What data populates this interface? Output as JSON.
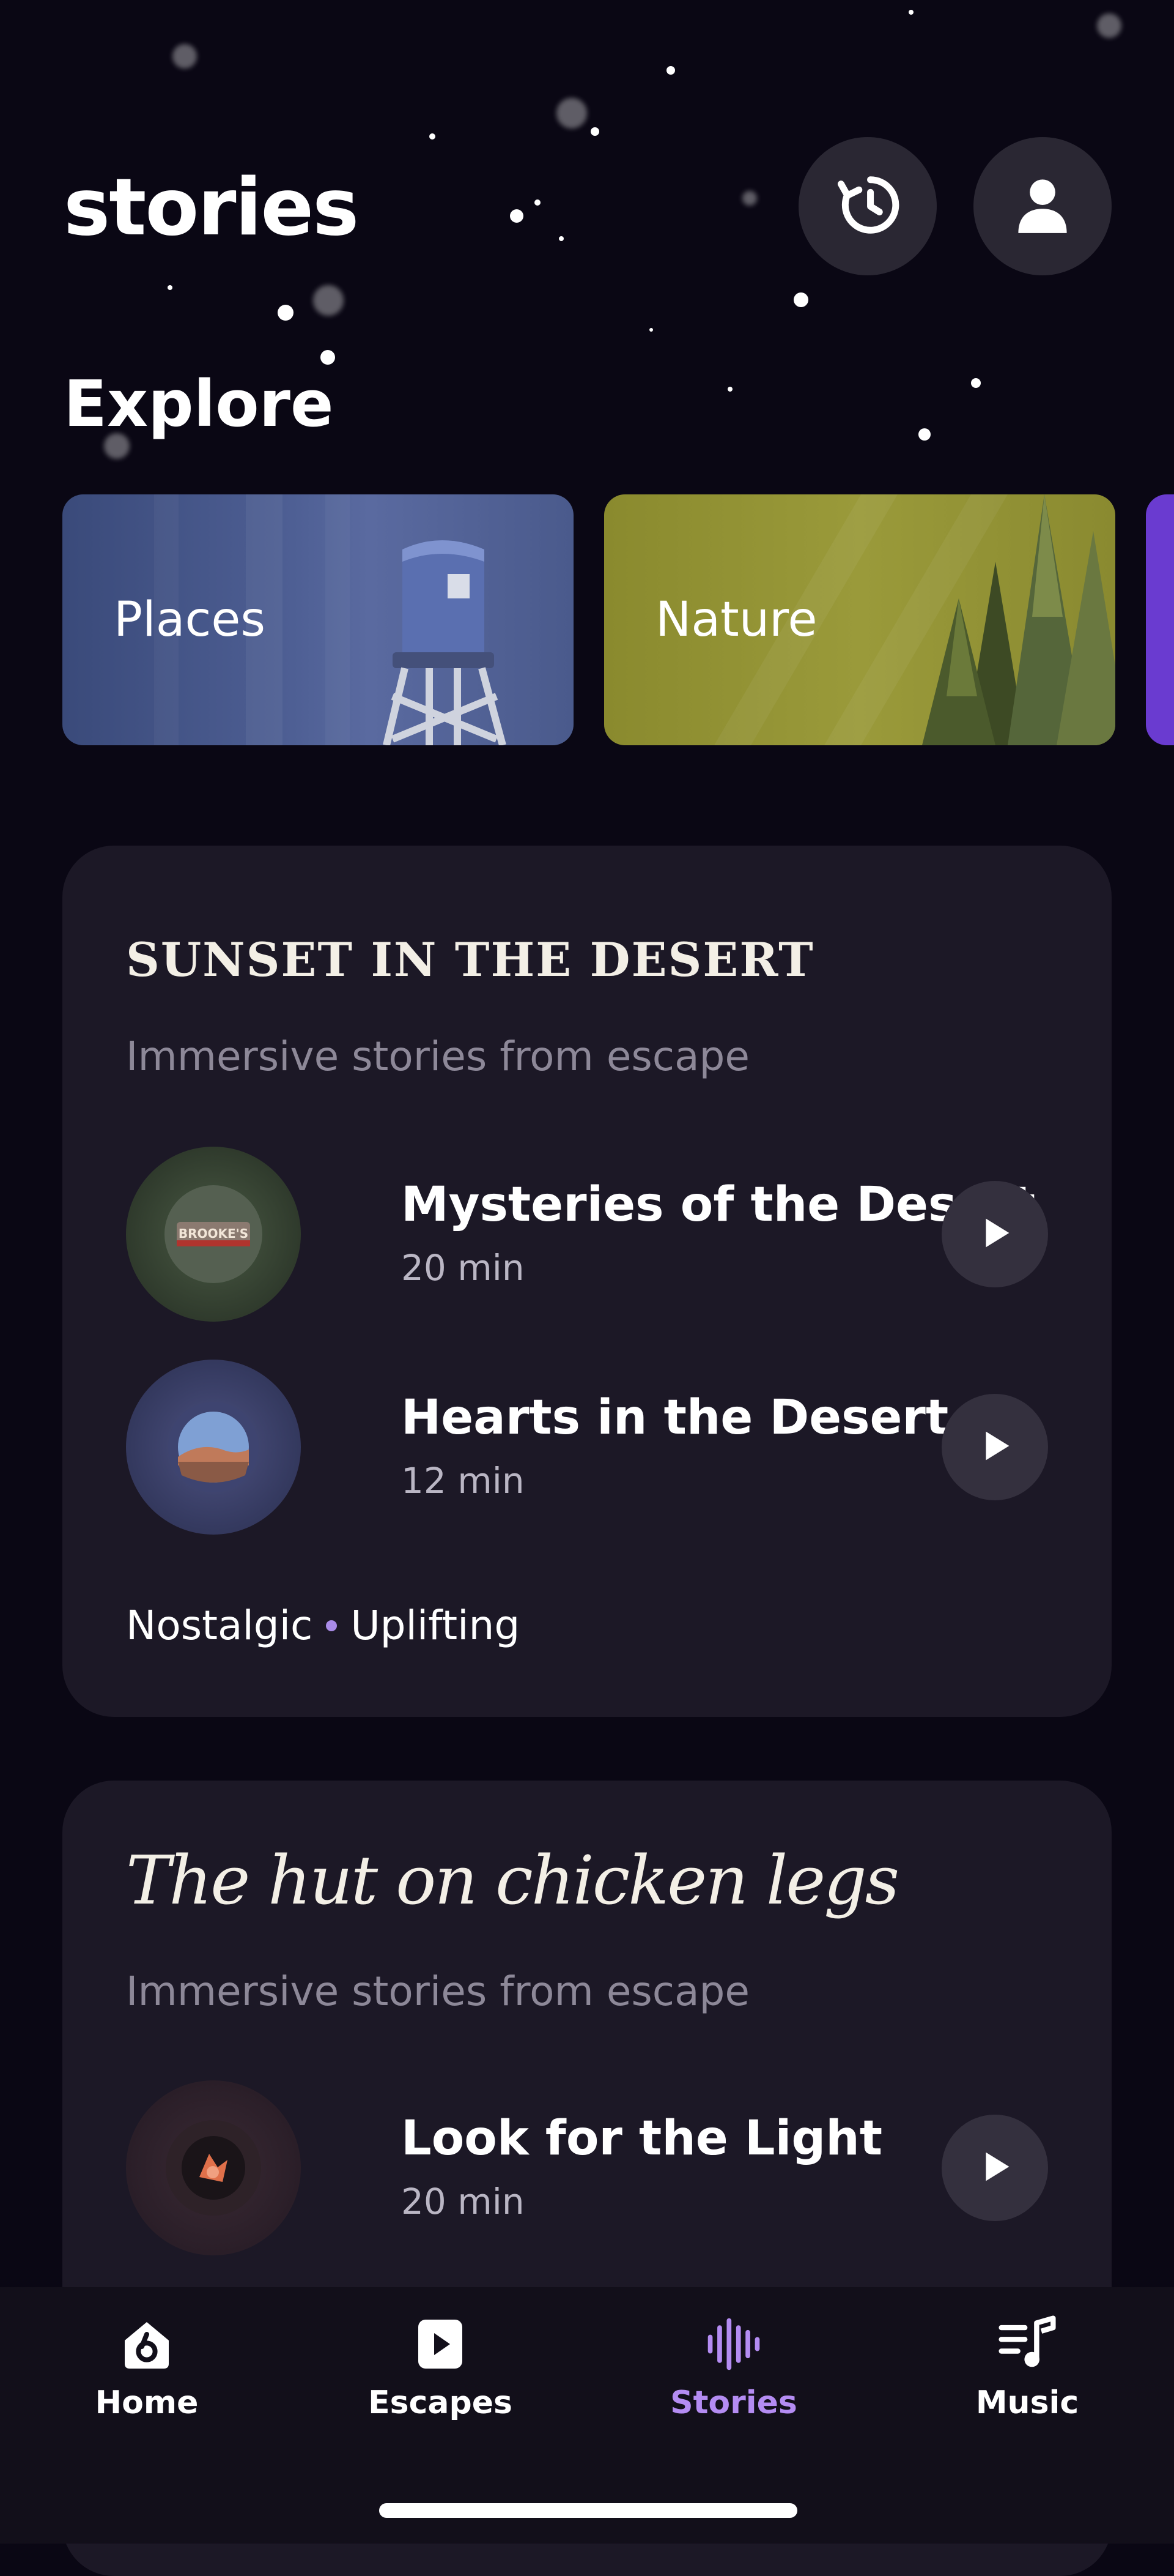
{
  "header": {
    "title": "stories",
    "history_icon": "history-icon",
    "profile_icon": "profile-icon"
  },
  "explore": {
    "heading": "Explore",
    "categories": [
      {
        "label": "Places",
        "color": "#4a5a8c"
      },
      {
        "label": "Nature",
        "color": "#8f8f33"
      }
    ]
  },
  "collections": [
    {
      "title": "SUNSET IN THE DESERT",
      "subtitle": "Immersive stories from escape",
      "stories": [
        {
          "title": "Mysteries of the Desert",
          "duration": "20 min",
          "thumb_text": "BROOKE'S"
        },
        {
          "title": "Hearts in the Desert",
          "duration": "12 min"
        }
      ],
      "tags": [
        "Nostalgic",
        "Uplifting"
      ]
    },
    {
      "title": "The hut on chicken legs",
      "subtitle": "Immersive stories from escape",
      "stories": [
        {
          "title": "Look for the Light",
          "duration": "20 min"
        }
      ]
    }
  ],
  "tabbar": {
    "tabs": [
      {
        "label": "Home",
        "icon": "home-icon"
      },
      {
        "label": "Escapes",
        "icon": "play-square-icon"
      },
      {
        "label": "Stories",
        "icon": "soundwave-icon",
        "active": true
      },
      {
        "label": "Music",
        "icon": "music-list-icon"
      }
    ],
    "active_color": "#b48cf2"
  }
}
